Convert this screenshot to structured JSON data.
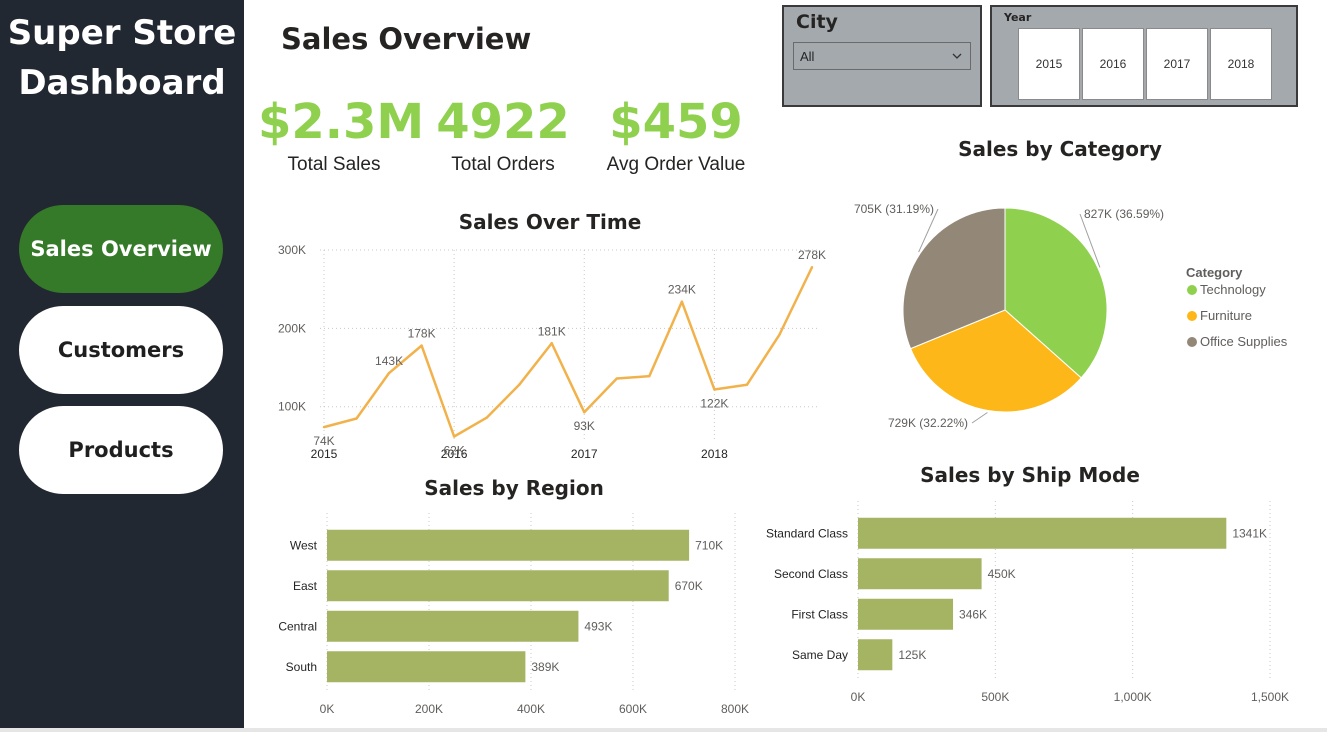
{
  "sidebar": {
    "brand_line1": "Super Store",
    "brand_line2": "Dashboard",
    "nav": [
      {
        "label": "Sales Overview",
        "active": true
      },
      {
        "label": "Customers",
        "active": false
      },
      {
        "label": "Products",
        "active": false
      }
    ]
  },
  "page_title": "Sales Overview",
  "kpis": [
    {
      "value": "$2.3M",
      "label": "Total Sales"
    },
    {
      "value": "4922",
      "label": "Total Orders"
    },
    {
      "value": "$459",
      "label": "Avg Order Value"
    }
  ],
  "city_slicer": {
    "title": "City",
    "selected": "All"
  },
  "year_slicer": {
    "title": "Year",
    "options": [
      "2015",
      "2016",
      "2017",
      "2018"
    ]
  },
  "colors": {
    "sidebar_bg": "#222831",
    "active_nav": "#357a28",
    "kpi_green": "#8fd14f",
    "line": "#f2b24b",
    "bar": "#a4b463",
    "technology": "#8fd14f",
    "furniture": "#fdb718",
    "office_supplies": "#938878",
    "slicer_bg": "#a3a9ad"
  },
  "chart_data": [
    {
      "type": "line",
      "title": "Sales Over Time",
      "x_tick_labels": [
        "2015",
        "2016",
        "2017",
        "2018"
      ],
      "y_ticks": [
        100000,
        200000,
        300000
      ],
      "y_tick_labels": [
        "100K",
        "200K",
        "300K"
      ],
      "ylim": [
        55000,
        300000
      ],
      "grid": true,
      "x": [
        "2015-Q1",
        "2015-Q2",
        "2015-Q3",
        "2015-Q4",
        "2016-Q1",
        "2016-Q2",
        "2016-Q3",
        "2016-Q4",
        "2017-Q1",
        "2017-Q2",
        "2017-Q3",
        "2017-Q4",
        "2018-Q1",
        "2018-Q2",
        "2018-Q3",
        "2018-Q4"
      ],
      "values": [
        74000,
        85000,
        143000,
        178000,
        62000,
        86000,
        128000,
        181000,
        93000,
        136000,
        139000,
        234000,
        122000,
        128000,
        192000,
        278000
      ],
      "data_labels": [
        "74K",
        null,
        "143K",
        "178K",
        "62K",
        null,
        null,
        "181K",
        "93K",
        null,
        null,
        "234K",
        "122K",
        null,
        null,
        "278K"
      ]
    },
    {
      "type": "pie",
      "title": "Sales by Category",
      "legend_title": "Category",
      "legend_position": "right",
      "slices": [
        {
          "name": "Technology",
          "value": 827000,
          "label": "827K (36.59%)"
        },
        {
          "name": "Furniture",
          "value": 729000,
          "label": "729K (32.22%)"
        },
        {
          "name": "Office Supplies",
          "value": 705000,
          "label": "705K (31.19%)"
        }
      ]
    },
    {
      "type": "bar",
      "orientation": "horizontal",
      "title": "Sales by Region",
      "categories": [
        "West",
        "East",
        "Central",
        "South"
      ],
      "values": [
        710000,
        670000,
        493000,
        389000
      ],
      "data_labels": [
        "710K",
        "670K",
        "493K",
        "389K"
      ],
      "xlim": [
        0,
        800000
      ],
      "x_ticks": [
        0,
        200000,
        400000,
        600000,
        800000
      ],
      "x_tick_labels": [
        "0K",
        "200K",
        "400K",
        "600K",
        "800K"
      ],
      "grid": true
    },
    {
      "type": "bar",
      "orientation": "horizontal",
      "title": "Sales by Ship Mode",
      "categories": [
        "Standard Class",
        "Second Class",
        "First Class",
        "Same Day"
      ],
      "values": [
        1341000,
        450000,
        346000,
        125000
      ],
      "data_labels": [
        "1341K",
        "450K",
        "346K",
        "125K"
      ],
      "xlim": [
        0,
        1500000
      ],
      "x_ticks": [
        0,
        500000,
        1000000,
        1500000
      ],
      "x_tick_labels": [
        "0K",
        "500K",
        "1,000K",
        "1,500K"
      ],
      "grid": true
    }
  ]
}
